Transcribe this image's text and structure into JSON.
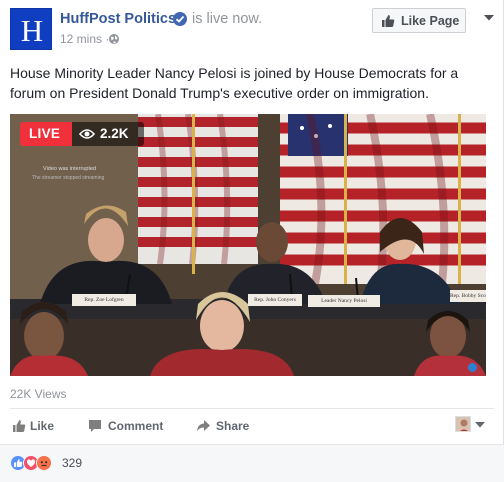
{
  "header": {
    "avatar_letter": "H",
    "page_name": "HuffPost Politics",
    "status": "is live now.",
    "time": "12 mins",
    "separator": "·",
    "privacy_icon": "globe-icon",
    "like_page_label": "Like Page",
    "menu_icon": "chevron-down-icon"
  },
  "post": {
    "text": "House Minority Leader Nancy Pelosi is joined by House Democrats for a forum on President Donald Trump's executive order on immigration."
  },
  "video": {
    "live_label": "LIVE",
    "viewers": "2.2K",
    "interrupted_title": "Video was interrupted",
    "interrupted_sub": "The streamer stopped streaming",
    "nameplates": [
      "Rep. Zoe Lofgren",
      "Rep. John Conyers",
      "Leader Nancy Pelosi",
      "Rep. Bobby Scott"
    ]
  },
  "stats": {
    "views": "22K Views"
  },
  "actions": {
    "like": "Like",
    "comment": "Comment",
    "share": "Share"
  },
  "reactions": {
    "types": [
      "like",
      "love",
      "angry"
    ],
    "count": "329"
  },
  "colors": {
    "brand_blue": "#365899",
    "live_red": "#f0303a",
    "huffpost_blue": "#0f3ec1"
  }
}
